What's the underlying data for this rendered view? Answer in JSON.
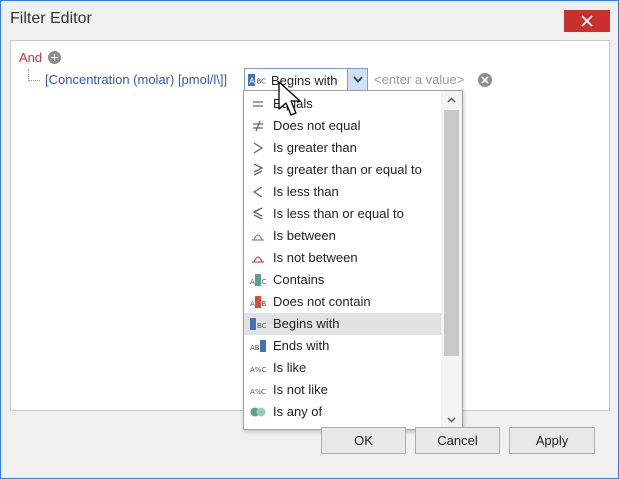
{
  "window": {
    "title": "Filter Editor",
    "close_icon": "close-icon"
  },
  "filter": {
    "group_operator": "And",
    "add_icon": "add-icon",
    "condition": {
      "field": "[Concentration (molar) [pmol/l\\]]",
      "operator": "Begins with",
      "value_placeholder": "<enter a value>",
      "remove_icon": "remove-icon"
    }
  },
  "operator_list": {
    "items": [
      {
        "label": "Equals",
        "icon": "equals-icon"
      },
      {
        "label": "Does not equal",
        "icon": "not-equal-icon"
      },
      {
        "label": "Is greater than",
        "icon": "greater-than-icon"
      },
      {
        "label": "Is greater than or equal to",
        "icon": "greater-or-equal-icon"
      },
      {
        "label": "Is less than",
        "icon": "less-than-icon"
      },
      {
        "label": "Is less than or equal to",
        "icon": "less-or-equal-icon"
      },
      {
        "label": "Is between",
        "icon": "between-icon"
      },
      {
        "label": "Is not between",
        "icon": "not-between-icon"
      },
      {
        "label": "Contains",
        "icon": "contains-icon"
      },
      {
        "label": "Does not contain",
        "icon": "does-not-contain-icon"
      },
      {
        "label": "Begins with",
        "icon": "begins-with-icon",
        "selected": true
      },
      {
        "label": "Ends with",
        "icon": "ends-with-icon"
      },
      {
        "label": "Is like",
        "icon": "is-like-icon"
      },
      {
        "label": "Is not like",
        "icon": "is-not-like-icon"
      },
      {
        "label": "Is any of",
        "icon": "is-any-of-icon"
      }
    ]
  },
  "buttons": {
    "ok": "OK",
    "cancel": "Cancel",
    "apply": "Apply"
  },
  "colors": {
    "accent_blue": "#2a5db0",
    "and_red": "#c0392b",
    "close_red": "#c9302c",
    "teal": "#5aa08c"
  }
}
